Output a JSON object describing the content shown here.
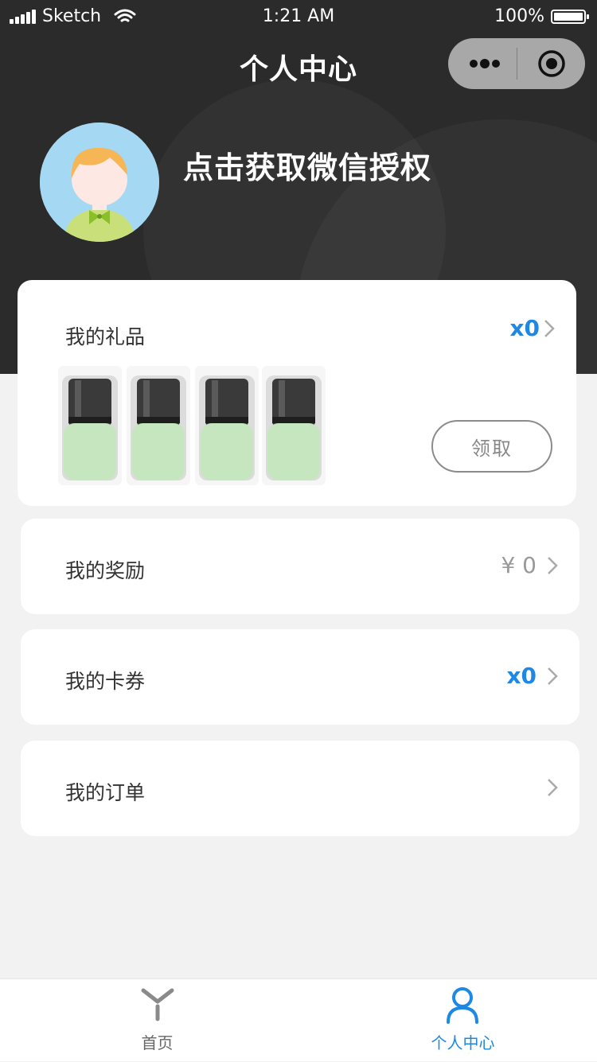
{
  "status_bar": {
    "carrier": "Sketch",
    "time": "1:21 AM",
    "battery": "100%"
  },
  "nav": {
    "title": "个人中心",
    "more_icon": "more-dots-icon",
    "close_icon": "target-circle-icon"
  },
  "profile": {
    "auth_prompt": "点击获取微信授权",
    "avatar_icon": "cartoon-avatar"
  },
  "gift_card": {
    "label": "我的礼品",
    "count": "x0",
    "claim_label": "领取",
    "pod_count": 4
  },
  "menu": [
    {
      "label": "我的奖励",
      "value": "¥ 0",
      "value_color": "#999999"
    },
    {
      "label": "我的卡券",
      "value": "x0",
      "value_color": "#1e88e5"
    },
    {
      "label": "我的订单",
      "value": "",
      "value_color": "#999999"
    }
  ],
  "tabbar": {
    "items": [
      {
        "label": "首页",
        "icon": "y-logo-icon",
        "active": false
      },
      {
        "label": "个人中心",
        "icon": "user-icon",
        "active": true
      }
    ]
  },
  "colors": {
    "header_bg": "#2b2b2b",
    "accent": "#1e88e5",
    "page_bg": "#f2f2f2"
  }
}
